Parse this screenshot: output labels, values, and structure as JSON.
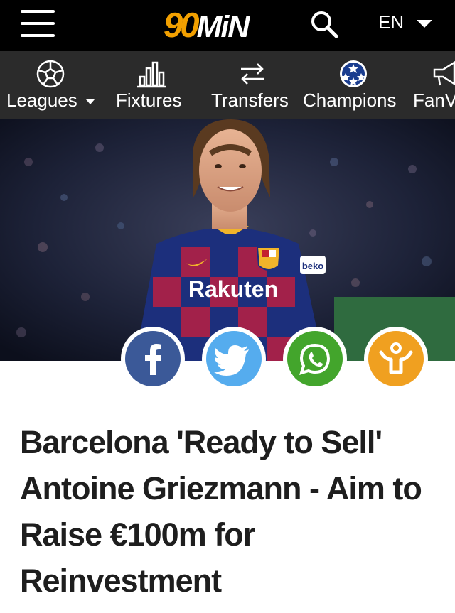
{
  "header": {
    "logo_num": "90",
    "logo_word": "MiN",
    "language": "EN"
  },
  "nav": {
    "items": [
      {
        "label": "Leagues",
        "icon": "soccer-ball-icon",
        "has_dropdown": true
      },
      {
        "label": "Fixtures",
        "icon": "bar-chart-icon"
      },
      {
        "label": "Transfers",
        "icon": "transfer-arrows-icon"
      },
      {
        "label": "Champions",
        "icon": "champions-league-ball-icon"
      },
      {
        "label": "FanView",
        "icon": "megaphone-icon"
      }
    ]
  },
  "hero": {
    "shirt_sponsor": "Rakuten",
    "sleeve_sponsor": "beko"
  },
  "share": [
    {
      "name": "facebook",
      "color": "#3b5998"
    },
    {
      "name": "twitter",
      "color": "#55acee"
    },
    {
      "name": "whatsapp",
      "color": "#43a52c"
    },
    {
      "name": "user-action",
      "color": "#f0a020"
    }
  ],
  "article": {
    "headline": "Barcelona 'Ready to Sell' Antoine Griezmann - Aim to Raise €100m for Reinvestment"
  }
}
